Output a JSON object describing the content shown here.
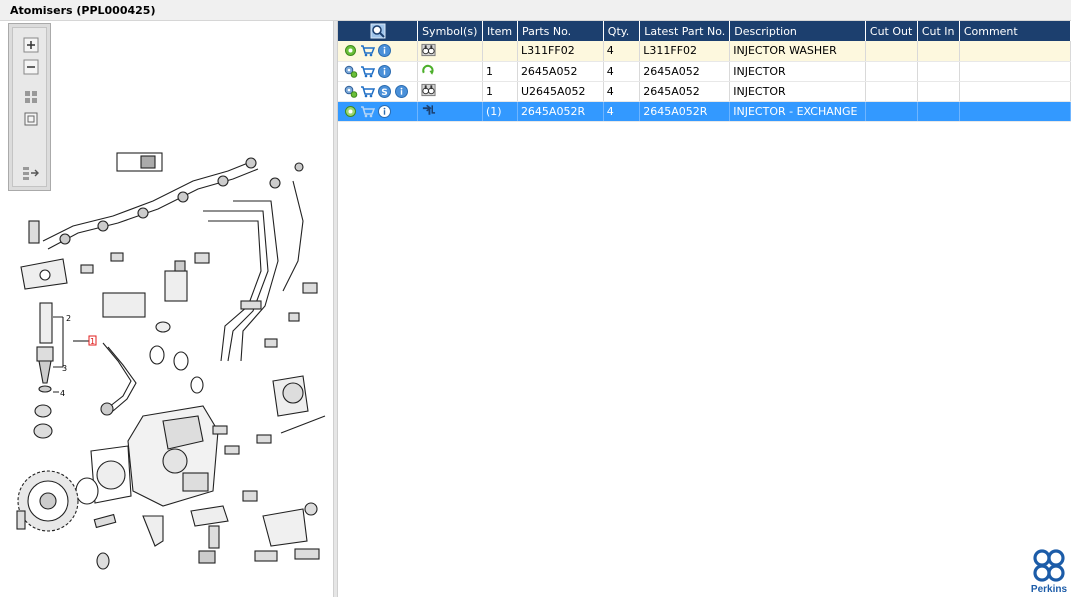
{
  "window": {
    "title": "Atomisers (PPL000425)"
  },
  "grid": {
    "columns": [
      "",
      "Symbol(s)",
      "Item",
      "Parts No.",
      "Qty.",
      "Latest Part No.",
      "Description",
      "Cut Out",
      "Cut In",
      "Comment"
    ],
    "rows": [
      {
        "item": "",
        "part_no": "L311FF02",
        "qty": "4",
        "latest_part_no": "L311FF02",
        "description": "INJECTOR WASHER",
        "cut_out": "",
        "cut_in": "",
        "comment": "",
        "row_icons": [
          "gear-icon",
          "cart-icon",
          "info-icon"
        ],
        "symbol": "binoculars-icon"
      },
      {
        "item": "1",
        "part_no": "2645A052",
        "qty": "4",
        "latest_part_no": "2645A052",
        "description": "INJECTOR",
        "cut_out": "",
        "cut_in": "",
        "comment": "",
        "row_icons": [
          "gears-icon",
          "cart-icon",
          "info-icon"
        ],
        "symbol": "exchange-arrow-icon"
      },
      {
        "item": "1",
        "part_no": "U2645A052",
        "qty": "4",
        "latest_part_no": "2645A052",
        "description": "INJECTOR",
        "cut_out": "",
        "cut_in": "",
        "comment": "",
        "row_icons": [
          "gears-icon",
          "cart-icon",
          "s-badge-icon",
          "info-icon"
        ],
        "symbol": "binoculars-icon"
      },
      {
        "item": "(1)",
        "part_no": "2645A052R",
        "qty": "4",
        "latest_part_no": "2645A052R",
        "description": "INJECTOR - EXCHANGE",
        "cut_out": "",
        "cut_in": "",
        "comment": "",
        "row_icons": [
          "gear-icon",
          "cart-icon",
          "info-icon"
        ],
        "symbol": "supersede-arrow-icon",
        "selected": true
      }
    ]
  },
  "diagram": {
    "callouts": [
      "1",
      "2",
      "3",
      "4"
    ]
  },
  "brand": {
    "name": "Perkins",
    "color": "#1c5ca8"
  },
  "colors": {
    "header_bg": "#1c3f6e",
    "selected_bg": "#3399ff",
    "highlight_row_bg": "#fdf8de"
  }
}
